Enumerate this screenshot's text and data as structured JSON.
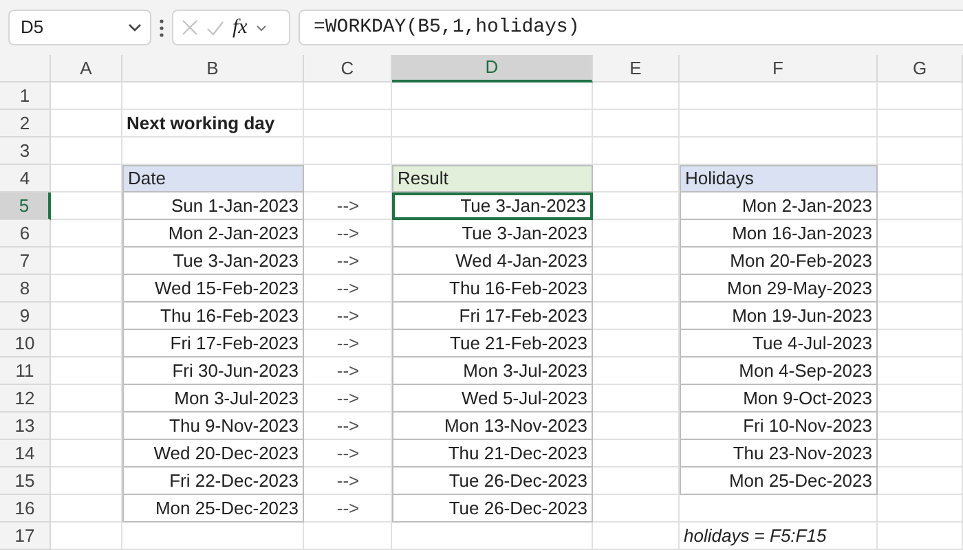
{
  "name_box": "D5",
  "fx_label": "fx",
  "formula": "=WORKDAY(B5,1,holidays)",
  "columns": [
    {
      "label": "A",
      "selected": false
    },
    {
      "label": "B",
      "selected": false
    },
    {
      "label": "C",
      "selected": false
    },
    {
      "label": "D",
      "selected": true
    },
    {
      "label": "E",
      "selected": false
    },
    {
      "label": "F",
      "selected": false
    },
    {
      "label": "G",
      "selected": false
    }
  ],
  "rows": [
    {
      "label": "1",
      "selected": false
    },
    {
      "label": "2",
      "selected": false
    },
    {
      "label": "3",
      "selected": false
    },
    {
      "label": "4",
      "selected": false
    },
    {
      "label": "5",
      "selected": true
    },
    {
      "label": "6",
      "selected": false
    },
    {
      "label": "7",
      "selected": false
    },
    {
      "label": "8",
      "selected": false
    },
    {
      "label": "9",
      "selected": false
    },
    {
      "label": "10",
      "selected": false
    },
    {
      "label": "11",
      "selected": false
    },
    {
      "label": "12",
      "selected": false
    },
    {
      "label": "13",
      "selected": false
    },
    {
      "label": "14",
      "selected": false
    },
    {
      "label": "15",
      "selected": false
    },
    {
      "label": "16",
      "selected": false
    },
    {
      "label": "17",
      "selected": false
    }
  ],
  "title": "Next working day",
  "date_table": {
    "header": "Date",
    "values": [
      "Sun 1-Jan-2023",
      "Mon 2-Jan-2023",
      "Tue 3-Jan-2023",
      "Wed 15-Feb-2023",
      "Thu 16-Feb-2023",
      "Fri 17-Feb-2023",
      "Fri 30-Jun-2023",
      "Mon 3-Jul-2023",
      "Thu 9-Nov-2023",
      "Wed 20-Dec-2023",
      "Fri 22-Dec-2023",
      "Mon 25-Dec-2023"
    ]
  },
  "arrows": [
    "-->",
    "-->",
    "-->",
    "-->",
    "-->",
    "-->",
    "-->",
    "-->",
    "-->",
    "-->",
    "-->",
    "-->"
  ],
  "result_table": {
    "header": "Result",
    "values": [
      {
        "text": "Tue 3-Jan-2023",
        "selected": true
      },
      {
        "text": "Tue 3-Jan-2023",
        "selected": false
      },
      {
        "text": "Wed 4-Jan-2023",
        "selected": false
      },
      {
        "text": "Thu 16-Feb-2023",
        "selected": false
      },
      {
        "text": "Fri 17-Feb-2023",
        "selected": false
      },
      {
        "text": "Tue 21-Feb-2023",
        "selected": false
      },
      {
        "text": "Mon 3-Jul-2023",
        "selected": false
      },
      {
        "text": "Wed 5-Jul-2023",
        "selected": false
      },
      {
        "text": "Mon 13-Nov-2023",
        "selected": false
      },
      {
        "text": "Thu 21-Dec-2023",
        "selected": false
      },
      {
        "text": "Tue 26-Dec-2023",
        "selected": false
      },
      {
        "text": "Tue 26-Dec-2023",
        "selected": false
      }
    ]
  },
  "holidays_table": {
    "header": "Holidays",
    "values": [
      "Mon 2-Jan-2023",
      "Mon 16-Jan-2023",
      "Mon 20-Feb-2023",
      "Mon 29-May-2023",
      "Mon 19-Jun-2023",
      "Tue 4-Jul-2023",
      "Mon 4-Sep-2023",
      "Mon 9-Oct-2023",
      "Fri 10-Nov-2023",
      "Thu 23-Nov-2023",
      "Mon 25-Dec-2023"
    ]
  },
  "note": "holidays = F5:F15"
}
